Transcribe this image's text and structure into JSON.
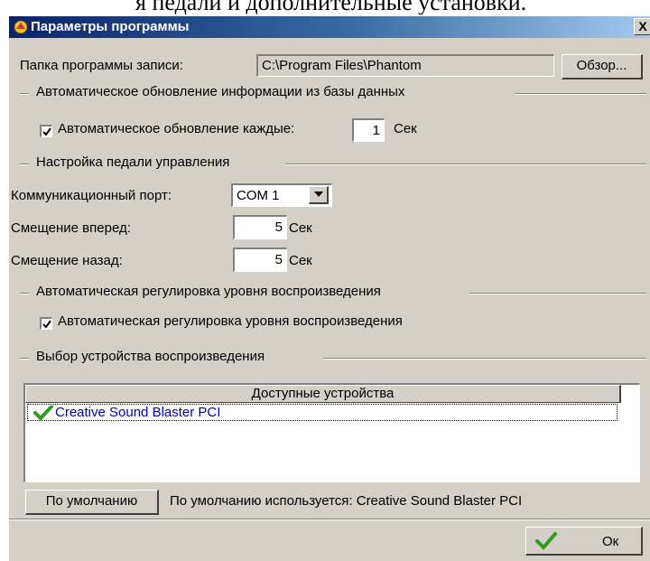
{
  "background_text": "я педали и дополнительные установки.",
  "window": {
    "title": "Параметры программы",
    "close_label": "X"
  },
  "program_folder": {
    "label": "Папка программы записи:",
    "value": "C:\\Program Files\\Phantom",
    "browse_label": "Обзор..."
  },
  "auto_update": {
    "group_title": "Автоматическое обновление информации из базы данных",
    "checkbox_label": "Автоматическое обновление каждые:",
    "checked": true,
    "value": "1",
    "unit": "Сек"
  },
  "pedal": {
    "group_title": "Настройка педали управления",
    "port_label": "Коммуникационный порт:",
    "port_value": "COM 1",
    "forward_label": "Смещение вперед:",
    "forward_value": "5",
    "forward_unit": "Сек",
    "back_label": "Смещение назад:",
    "back_value": "5",
    "back_unit": "Сек"
  },
  "playback_level": {
    "group_title": "Автоматическая регулировка уровня воспроизведения",
    "checkbox_label": "Автоматическая регулировка уровня воспроизведения",
    "checked": true
  },
  "device": {
    "group_title": "Выбор устройства воспроизведения",
    "column_header": "Доступные устройства",
    "devices": [
      "Creative Sound Blaster PCI"
    ],
    "default_button": "По умолчанию",
    "default_info": "По умолчанию используется: Creative Sound Blaster PCI"
  },
  "footer": {
    "ok_label": "Ок"
  },
  "colors": {
    "title_start": "#0a246a",
    "title_end": "#a6caf0",
    "face": "#d4d0c8",
    "check_green": "#2e9a1e",
    "device_text": "#0000c0"
  }
}
